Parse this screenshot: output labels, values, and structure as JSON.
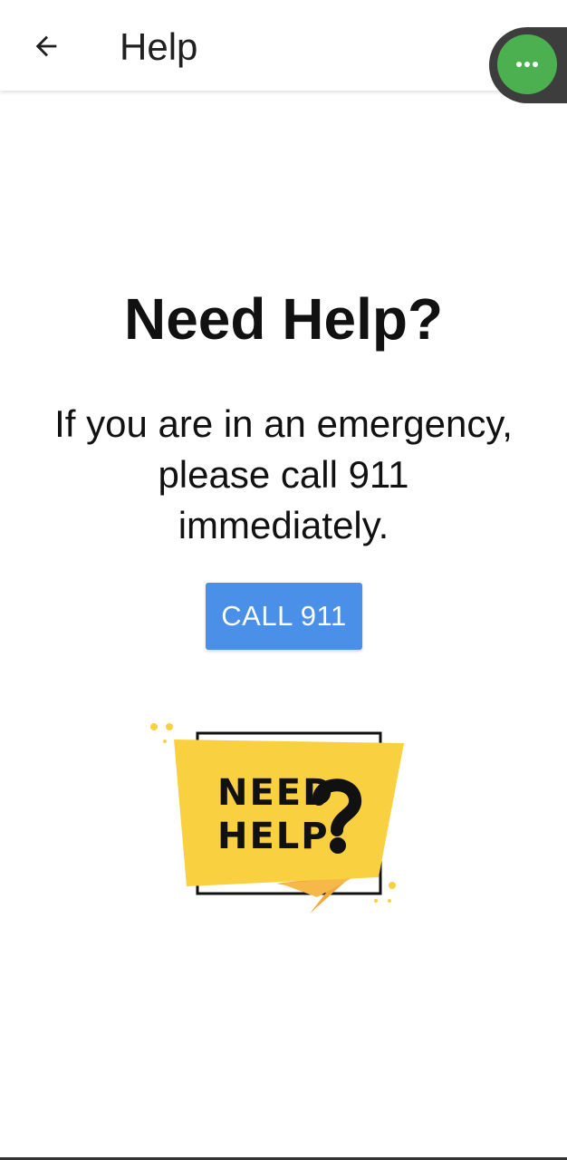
{
  "app_bar": {
    "title": "Help",
    "back_icon": "arrow-left-icon"
  },
  "overlay": {
    "icon": "more-horizontal-icon",
    "color": "#4caf50"
  },
  "main": {
    "heading": "Need Help?",
    "message": "If you are in an emergency, please call 911 immediately.",
    "call_button_label": "CALL 911",
    "call_button_color": "#4a90e8"
  },
  "illustration": {
    "line1": "NEED",
    "line2": "HELP",
    "accent_color": "#f9d03f"
  }
}
